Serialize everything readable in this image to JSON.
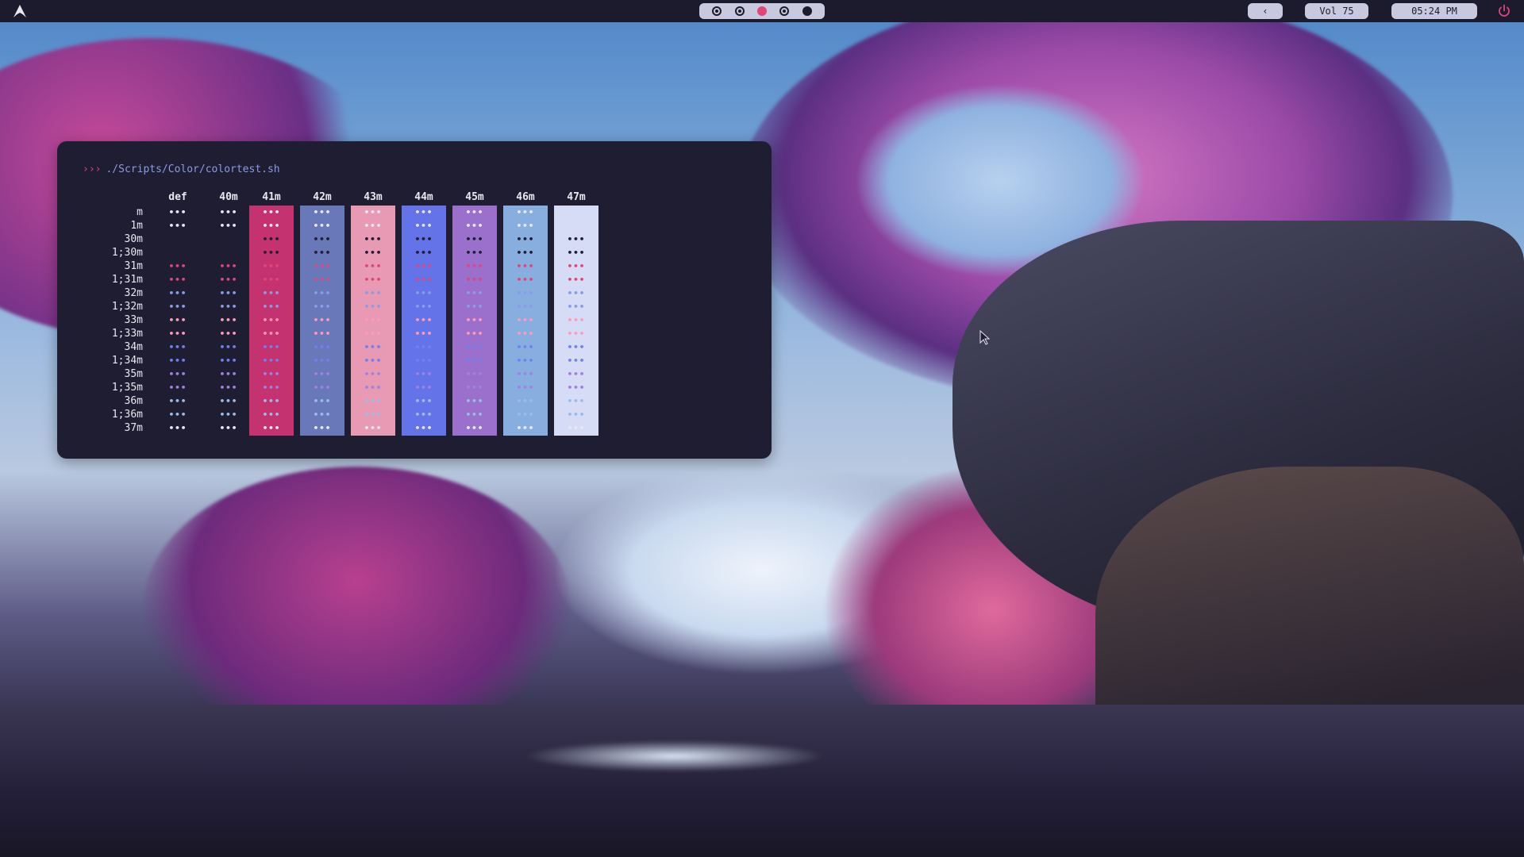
{
  "topbar": {
    "workspaces": [
      "ring",
      "ring",
      "active",
      "ring",
      "filled"
    ],
    "back_label": "‹",
    "volume": "Vol 75",
    "clock": "05:24 PM"
  },
  "terminal": {
    "prompt_arrows": "›››",
    "command": "./Scripts/Color/colortest.sh",
    "columns": [
      "def",
      "40m",
      "41m",
      "42m",
      "43m",
      "44m",
      "45m",
      "46m",
      "47m"
    ],
    "rows": [
      "m",
      "1m",
      "30m",
      "1;30m",
      "31m",
      "1;31m",
      "32m",
      "1;32m",
      "33m",
      "1;33m",
      "34m",
      "1;34m",
      "35m",
      "1;35m",
      "36m",
      "1;36m",
      "37m"
    ],
    "cell_glyph": "•••",
    "bg_colors": [
      "",
      "",
      "#c4326f",
      "#6878b8",
      "#e89ab4",
      "#6473e8",
      "#9a70cc",
      "#88aee0",
      "#d6dcf6"
    ],
    "fg_colors": [
      "#e8e8f2",
      "#e8e8f2",
      "#1e1d31",
      "#1e1d31",
      "#e0457b",
      "#e0457b",
      "#8a9be8",
      "#8a9be8",
      "#ff9ab8",
      "#ff9ab8",
      "#7080f0",
      "#7080f0",
      "#a080e0",
      "#a080e0",
      "#9bbbe8",
      "#9bbbe8",
      "#e8e8f2"
    ]
  }
}
